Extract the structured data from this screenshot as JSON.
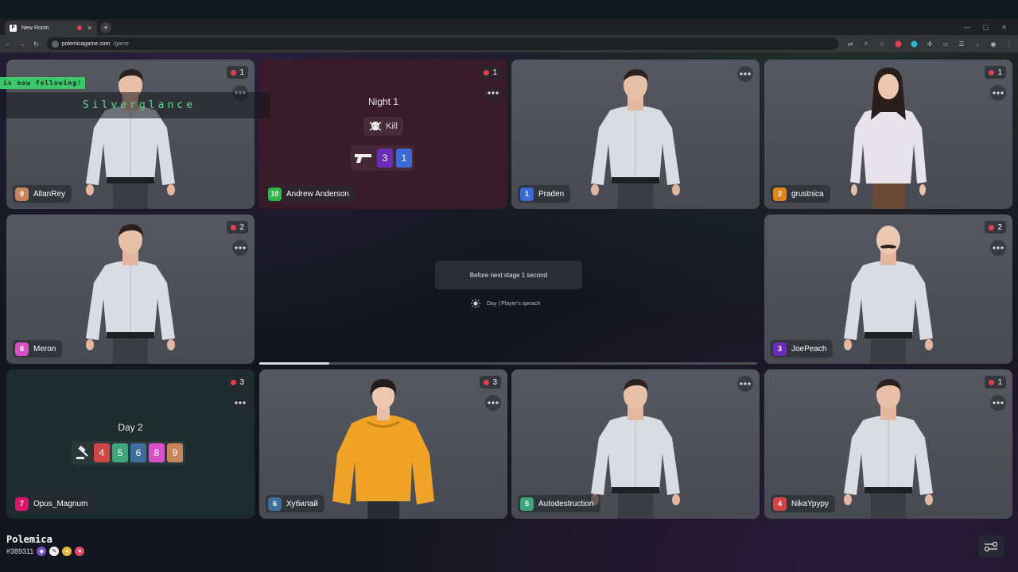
{
  "browser": {
    "tab_title": "New Room",
    "tab_favicon": "P",
    "new_tab": "+",
    "url_host": "polemicagame.com",
    "url_path": "/game"
  },
  "overlay": {
    "follow_text": "is now following!",
    "follower_name": "Silverglance"
  },
  "players": {
    "p9": {
      "num": "9",
      "name": "AllanRey",
      "fouls": "1",
      "color": "#c8855a"
    },
    "p10": {
      "num": "10",
      "name": "Andrew Anderson",
      "fouls": "1",
      "color": "#2eb84a"
    },
    "p1": {
      "num": "1",
      "name": "Praden",
      "color": "#3a6ad8"
    },
    "p2": {
      "num": "2",
      "name": "grustnica",
      "fouls": "1",
      "color": "#e0861e"
    },
    "p8": {
      "num": "8",
      "name": "Meron",
      "fouls": "2",
      "color": "#d84fc8"
    },
    "p3": {
      "num": "3",
      "name": "JoePeach",
      "fouls": "2",
      "color": "#6a2db5"
    },
    "p7": {
      "num": "7",
      "name": "Opus_Magnum",
      "fouls": "3",
      "color": "#d8156a"
    },
    "p6": {
      "num": "6",
      "name": "Хубилай",
      "fouls": "3",
      "color": "#3e6e9c"
    },
    "p5": {
      "num": "5",
      "name": "Autodestruction",
      "color": "#3fa57a"
    },
    "p4": {
      "num": "4",
      "name": "NikaYpypy",
      "fouls": "1",
      "color": "#d04646"
    }
  },
  "night": {
    "title": "Night 1",
    "kill_label": "Kill",
    "shots": [
      "3",
      "1"
    ]
  },
  "day": {
    "title": "Day 2",
    "nominees": [
      "4",
      "5",
      "6",
      "8",
      "9"
    ]
  },
  "center": {
    "notice": "Before next stage 1 second",
    "phase": "Day | Player's speach",
    "progress": 0.14
  },
  "footer": {
    "brand": "Polemica",
    "room_id": "#389311"
  },
  "icons": {
    "more": "more-icon",
    "foul": "foul-icon",
    "skull": "skull-icon",
    "gun": "gun-icon",
    "gavel": "gavel-icon",
    "sun": "sun-icon",
    "settings": "settings-icon"
  }
}
